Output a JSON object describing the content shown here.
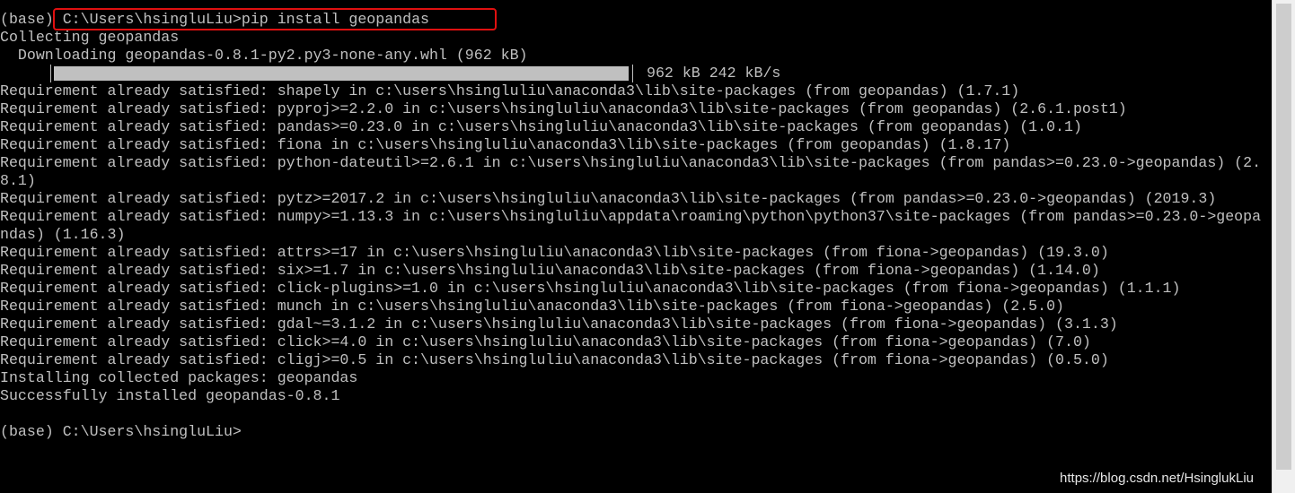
{
  "terminal": {
    "prompt_prefix": "(base) ",
    "command_path": "C:\\Users\\hsingluLiu>",
    "command": "pip install geopandas",
    "lines": [
      "Collecting geopandas",
      "  Downloading geopandas-0.8.1-py2.py3-none-any.whl (962 kB)",
      "Requirement already satisfied: shapely in c:\\users\\hsingluliu\\anaconda3\\lib\\site-packages (from geopandas) (1.7.1)",
      "Requirement already satisfied: pyproj>=2.2.0 in c:\\users\\hsingluliu\\anaconda3\\lib\\site-packages (from geopandas) (2.6.1.post1)",
      "Requirement already satisfied: pandas>=0.23.0 in c:\\users\\hsingluliu\\anaconda3\\lib\\site-packages (from geopandas) (1.0.1)",
      "Requirement already satisfied: fiona in c:\\users\\hsingluliu\\anaconda3\\lib\\site-packages (from geopandas) (1.8.17)",
      "Requirement already satisfied: python-dateutil>=2.6.1 in c:\\users\\hsingluliu\\anaconda3\\lib\\site-packages (from pandas>=0.23.0->geopandas) (2.",
      "8.1)",
      "Requirement already satisfied: pytz>=2017.2 in c:\\users\\hsingluliu\\anaconda3\\lib\\site-packages (from pandas>=0.23.0->geopandas) (2019.3)",
      "Requirement already satisfied: numpy>=1.13.3 in c:\\users\\hsingluliu\\appdata\\roaming\\python\\python37\\site-packages (from pandas>=0.23.0->geopa",
      "ndas) (1.16.3)",
      "Requirement already satisfied: attrs>=17 in c:\\users\\hsingluliu\\anaconda3\\lib\\site-packages (from fiona->geopandas) (19.3.0)",
      "Requirement already satisfied: six>=1.7 in c:\\users\\hsingluliu\\anaconda3\\lib\\site-packages (from fiona->geopandas) (1.14.0)",
      "Requirement already satisfied: click-plugins>=1.0 in c:\\users\\hsingluliu\\anaconda3\\lib\\site-packages (from fiona->geopandas) (1.1.1)",
      "Requirement already satisfied: munch in c:\\users\\hsingluliu\\anaconda3\\lib\\site-packages (from fiona->geopandas) (2.5.0)",
      "Requirement already satisfied: gdal~=3.1.2 in c:\\users\\hsingluliu\\anaconda3\\lib\\site-packages (from fiona->geopandas) (3.1.3)",
      "Requirement already satisfied: click>=4.0 in c:\\users\\hsingluliu\\anaconda3\\lib\\site-packages (from fiona->geopandas) (7.0)",
      "Requirement already satisfied: cligj>=0.5 in c:\\users\\hsingluliu\\anaconda3\\lib\\site-packages (from fiona->geopandas) (0.5.0)",
      "Installing collected packages: geopandas",
      "Successfully installed geopandas-0.8.1",
      "",
      "(base) C:\\Users\\hsingluLiu>"
    ],
    "progress": {
      "fraction": 1.0,
      "stats": "962 kB 242 kB/s"
    }
  },
  "watermark": "https://blog.csdn.net/HsinglukLiu",
  "colors": {
    "background": "#000000",
    "text": "#c0c0c0",
    "highlight": "#e01010"
  }
}
